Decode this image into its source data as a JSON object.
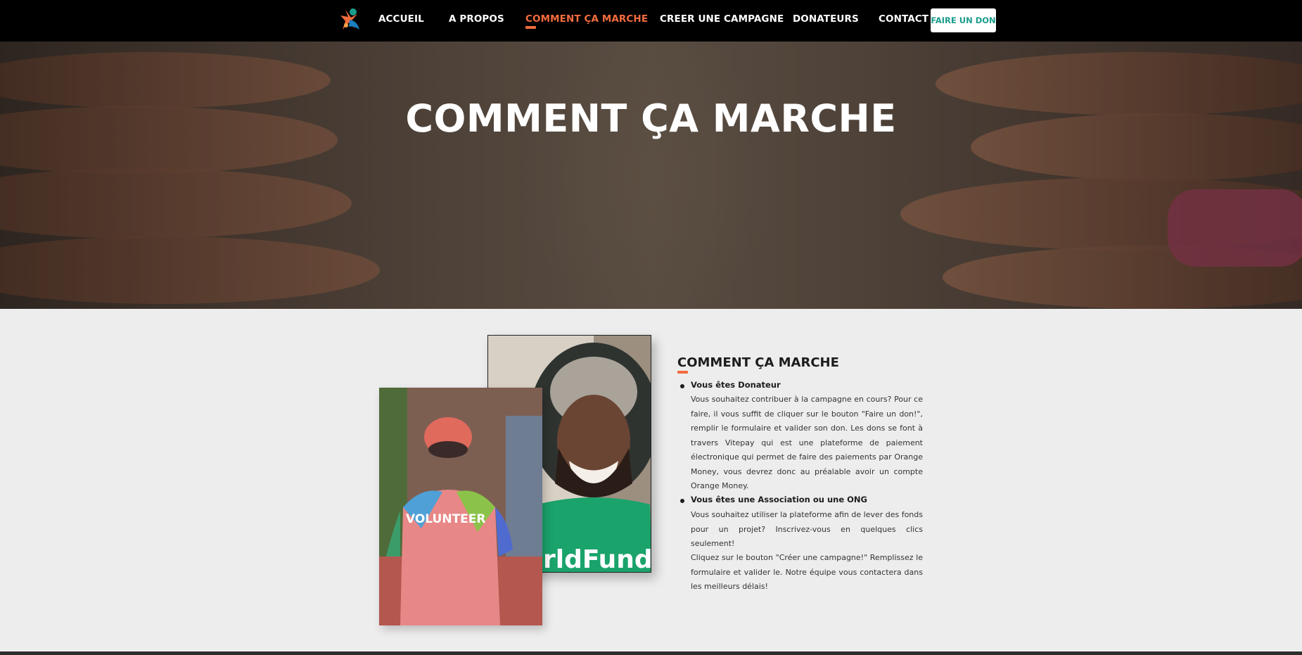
{
  "nav": {
    "items": [
      {
        "label": "ACCUEIL"
      },
      {
        "label": "A PROPOS"
      },
      {
        "label": "COMMENT ÇA MARCHE"
      },
      {
        "label": "CREER UNE CAMPAGNE"
      },
      {
        "label": "DONATEURS"
      },
      {
        "label": "CONTACT"
      }
    ],
    "cta_label": "FAIRE UN DON",
    "active_label": "COMMENT ÇA MARCHE"
  },
  "hero": {
    "title": "COMMENT ÇA MARCHE"
  },
  "section": {
    "title": "COMMENT ÇA MARCHE",
    "items": [
      {
        "heading": "Vous êtes Donateur",
        "text": "Vous souhaitez contribuer à la campagne en cours? Pour ce faire, il vous suffit de cliquer sur le bouton \"Faire un don!\", remplir le formulaire et valider son don. Les dons se font à travers Vitepay qui est une plateforme de paiement électronique qui permet de faire des paiements par Orange Money, vous devrez donc au préalable avoir un compte Orange Money."
      },
      {
        "heading": "Vous êtes une Association ou une ONG",
        "text": "Vous souhaitez utiliser la plateforme afin de lever des fonds pour un projet? Inscrivez-vous en quelques clics seulement!",
        "text2": "Cliquez sur le bouton \"Créer une campagne!\" Remplissez le formulaire et valider le. Notre équipe vous contactera dans les meilleurs délais!"
      }
    ]
  },
  "photos": {
    "front_shirt_text": "VOLUNTEER",
    "back_shirt_text": "rldFund"
  },
  "colors": {
    "accent": "#f36c3d",
    "cta_text": "#1a9c8c",
    "navbar_bg": "#000000",
    "content_bg": "#ededed"
  }
}
